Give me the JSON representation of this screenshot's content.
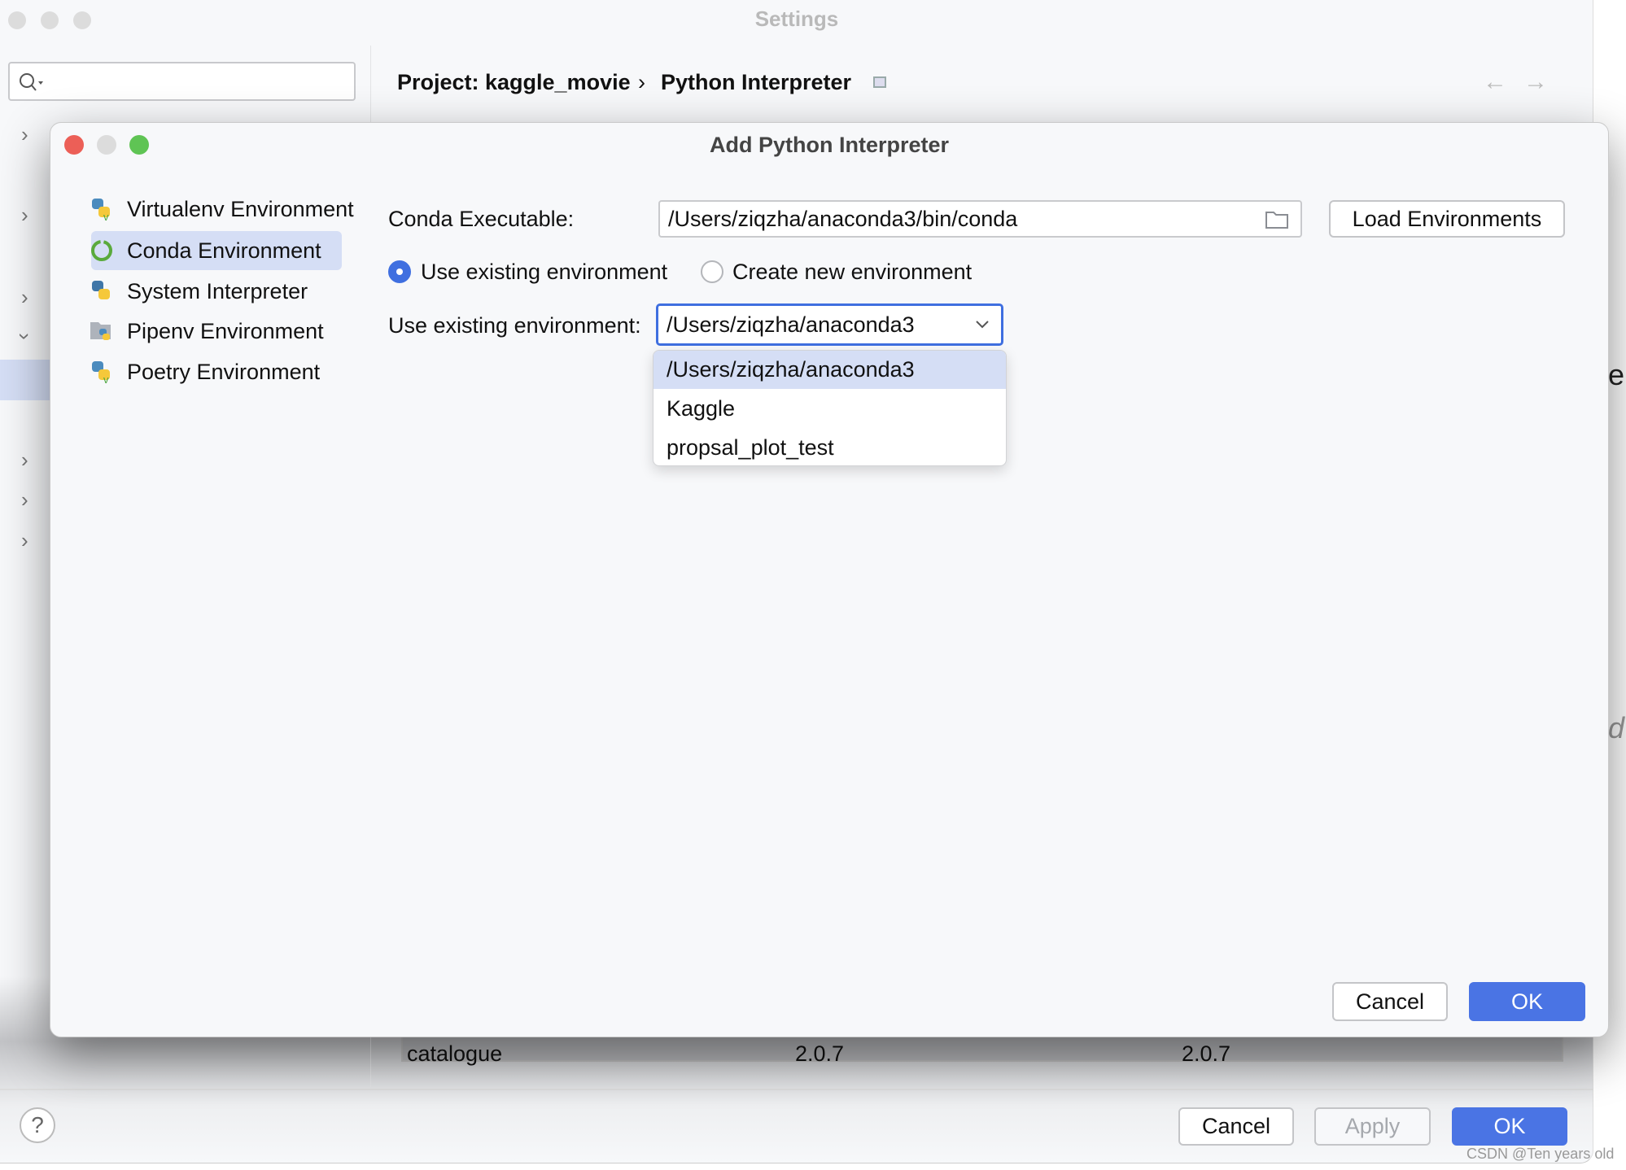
{
  "settings": {
    "title": "Settings",
    "breadcrumb": [
      "Project: kaggle_movie",
      "Python Interpreter"
    ],
    "search_placeholder": "",
    "table_row": {
      "name": "catalogue",
      "version": "2.0.7",
      "latest": "2.0.7"
    },
    "buttons": {
      "cancel": "Cancel",
      "apply": "Apply",
      "ok": "OK",
      "help": "?"
    },
    "right_edge_text": [
      "e",
      "d"
    ]
  },
  "dialog": {
    "title": "Add Python Interpreter",
    "types": [
      {
        "label": "Virtualenv Environment",
        "icon": "python-virtualenv-icon"
      },
      {
        "label": "Conda Environment",
        "icon": "conda-icon",
        "selected": true
      },
      {
        "label": "System Interpreter",
        "icon": "python-icon"
      },
      {
        "label": "Pipenv Environment",
        "icon": "pipenv-icon"
      },
      {
        "label": "Poetry Environment",
        "icon": "poetry-icon"
      }
    ],
    "conda_executable_label": "Conda Executable:",
    "conda_executable_value": "/Users/ziqzha/anaconda3/bin/conda",
    "load_environments": "Load Environments",
    "radio_existing": "Use existing environment",
    "radio_new": "Create new environment",
    "radio_selected": "existing",
    "existing_env_label": "Use existing environment:",
    "existing_env_value": "/Users/ziqzha/anaconda3",
    "env_options": [
      "/Users/ziqzha/anaconda3",
      "Kaggle",
      "propsal_plot_test"
    ],
    "cancel": "Cancel",
    "ok": "OK"
  },
  "watermark": "CSDN @Ten years old",
  "colors": {
    "accent": "#4a74e4",
    "selection": "#d5def5"
  }
}
